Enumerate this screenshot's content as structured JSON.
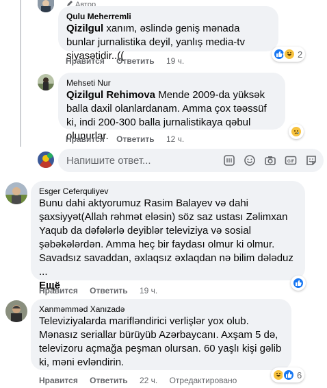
{
  "colors": {
    "bubble": "#f0f2f5",
    "meta": "#65676b",
    "like": "#1877f2",
    "emoji": "#f7c23e"
  },
  "comments": [
    {
      "author": "Qulu Meherremli",
      "author_tag": "Автор",
      "mention": "Qizilgul",
      "text": " xanım, əslində geniş mənada bunlar jurnalistika deyil, yanlış media-tv siyasətidir..((",
      "actions": {
        "like": "Нравится",
        "reply": "Ответить",
        "time": "19 ч."
      },
      "reactions": {
        "icons": [
          "like-icon",
          "haha-icon"
        ],
        "count": "2"
      }
    },
    {
      "author": "Mehseti Nur",
      "mention": "Qizilgul Rehimova",
      "text": " Mende 2009-da yüksək balla daxil olanlardanam. Amma çox təəssüf ki, indi 200-300 balla jurnalistikaya qəbul olunurlar.",
      "actions": {
        "like": "Нравится",
        "reply": "Ответить",
        "time": "12 ч."
      },
      "reactions": {
        "icons": [
          "sad-icon"
        ],
        "count": ""
      }
    },
    {
      "author": "Esger Ceferquliyev",
      "text": "Bunu dahi aktyorumuz Rasim Balayev və dahi şaxsiyyət(Allah rəhmət eləsin) söz saz ustası Zəlimxan Yaqub da dəfələrlə deyiblər televiziya və sosial şəbəkələrdən. Amma heç bir faydası olmur ki olmur. Savadsız savaddan, əxlaqsız əxlaqdan nə bilim dələduz ...",
      "more": "Ещё",
      "actions": {
        "like": "Нравится",
        "reply": "Ответить",
        "time": "19 ч."
      },
      "reactions": {
        "icons": [
          "like-icon"
        ],
        "count": ""
      }
    },
    {
      "author": "Xanməmməd Xanızadə",
      "text": "Televiziyalarda marifləndirici verlişlər yox olub. Mənasız seriallar bürüyüb Azərbaycanı. Axşam 5 də, televizoru açmağa peşman olursan. 60 yaşlı kişi gəlib ki, məni evləndirin.",
      "actions": {
        "like": "Нравится",
        "reply": "Ответить",
        "time": "22 ч.",
        "edited": "Отредактировано"
      },
      "reactions": {
        "icons": [
          "haha-icon",
          "like-icon"
        ],
        "count": "6"
      }
    }
  ],
  "composer": {
    "placeholder": "Напишите ответ...",
    "tools": [
      "sticker-icon",
      "emoji-icon",
      "camera-icon",
      "gif-icon",
      "sticker-pack-icon"
    ]
  }
}
